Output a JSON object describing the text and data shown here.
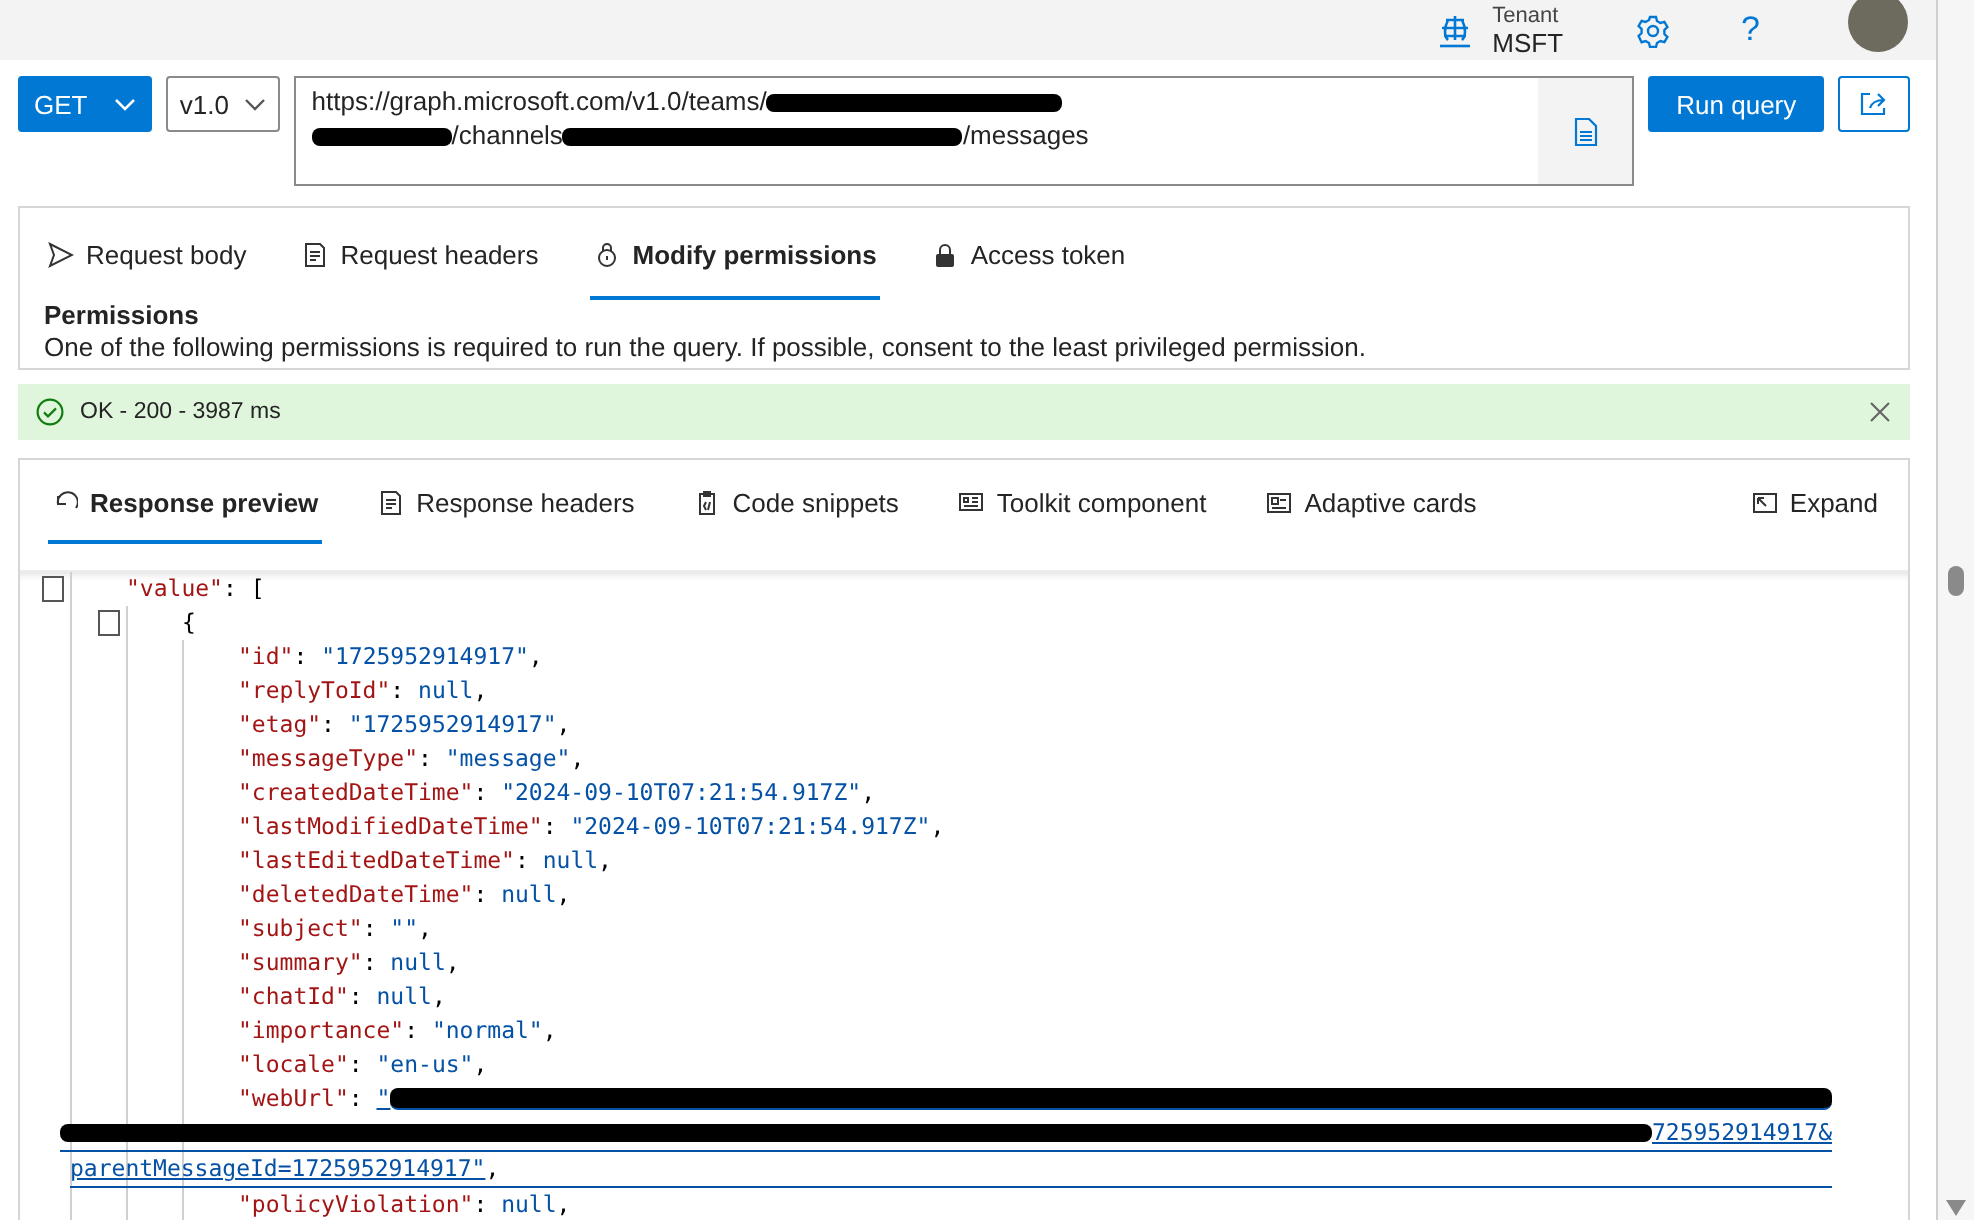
{
  "header": {
    "tenant_label": "Tenant",
    "tenant": "MSFT",
    "help": "?"
  },
  "request": {
    "method": "GET",
    "version": "v1.0",
    "run_label": "Run query",
    "url_lines": [
      [
        {
          "kind": "text",
          "text": "https://graph.microsoft.com/v1.0/teams/"
        },
        {
          "kind": "redaction"
        }
      ],
      [
        {
          "kind": "redaction"
        },
        {
          "kind": "text",
          "text": "/channels"
        },
        {
          "kind": "redaction"
        },
        {
          "kind": "text",
          "text": "/messages"
        }
      ]
    ]
  },
  "request_tabs": [
    {
      "label": "Request body",
      "selected": false
    },
    {
      "label": "Request headers",
      "selected": false
    },
    {
      "label": "Modify permissions",
      "selected": true
    },
    {
      "label": "Access token",
      "selected": false
    }
  ],
  "permissions": {
    "title": "Permissions",
    "text": "One of the following permissions is required to run the query. If possible, consent to the least privileged permission."
  },
  "status": {
    "text": "OK - 200 - 3987 ms"
  },
  "response_tabs": [
    {
      "label": "Response preview",
      "selected": true
    },
    {
      "label": "Response headers",
      "selected": false
    },
    {
      "label": "Code snippets",
      "selected": false
    },
    {
      "label": "Toolkit component",
      "selected": false
    },
    {
      "label": "Adaptive cards",
      "selected": false
    }
  ],
  "expand": "Expand",
  "code": [
    {
      "foldable": true,
      "parts": [
        {
          "kind": "key",
          "text": "\"value\""
        },
        {
          "kind": "punct",
          "text": ": ["
        }
      ],
      "children": [
        {
          "foldable": true,
          "parts": [
            {
              "kind": "punct",
              "text": "{"
            }
          ],
          "children": [
            {
              "parts": [
                {
                  "kind": "key",
                  "text": "\"id\""
                },
                {
                  "kind": "punct",
                  "text": ": "
                },
                {
                  "kind": "string",
                  "text": "\"1725952914917\""
                },
                {
                  "kind": "punct",
                  "text": ","
                }
              ]
            },
            {
              "parts": [
                {
                  "kind": "key",
                  "text": "\"replyToId\""
                },
                {
                  "kind": "punct",
                  "text": ": "
                },
                {
                  "kind": "null",
                  "text": "null"
                },
                {
                  "kind": "punct",
                  "text": ","
                }
              ]
            },
            {
              "parts": [
                {
                  "kind": "key",
                  "text": "\"etag\""
                },
                {
                  "kind": "punct",
                  "text": ": "
                },
                {
                  "kind": "string",
                  "text": "\"1725952914917\""
                },
                {
                  "kind": "punct",
                  "text": ","
                }
              ]
            },
            {
              "parts": [
                {
                  "kind": "key",
                  "text": "\"messageType\""
                },
                {
                  "kind": "punct",
                  "text": ": "
                },
                {
                  "kind": "string",
                  "text": "\"message\""
                },
                {
                  "kind": "punct",
                  "text": ","
                }
              ]
            },
            {
              "parts": [
                {
                  "kind": "key",
                  "text": "\"createdDateTime\""
                },
                {
                  "kind": "punct",
                  "text": ": "
                },
                {
                  "kind": "string",
                  "text": "\"2024-09-10T07:21:54.917Z\""
                },
                {
                  "kind": "punct",
                  "text": ","
                }
              ]
            },
            {
              "parts": [
                {
                  "kind": "key",
                  "text": "\"lastModifiedDateTime\""
                },
                {
                  "kind": "punct",
                  "text": ": "
                },
                {
                  "kind": "string",
                  "text": "\"2024-09-10T07:21:54.917Z\""
                },
                {
                  "kind": "punct",
                  "text": ","
                }
              ]
            },
            {
              "parts": [
                {
                  "kind": "key",
                  "text": "\"lastEditedDateTime\""
                },
                {
                  "kind": "punct",
                  "text": ": "
                },
                {
                  "kind": "null",
                  "text": "null"
                },
                {
                  "kind": "punct",
                  "text": ","
                }
              ]
            },
            {
              "parts": [
                {
                  "kind": "key",
                  "text": "\"deletedDateTime\""
                },
                {
                  "kind": "punct",
                  "text": ": "
                },
                {
                  "kind": "null",
                  "text": "null"
                },
                {
                  "kind": "punct",
                  "text": ","
                }
              ]
            },
            {
              "parts": [
                {
                  "kind": "key",
                  "text": "\"subject\""
                },
                {
                  "kind": "punct",
                  "text": ": "
                },
                {
                  "kind": "string",
                  "text": "\"\""
                },
                {
                  "kind": "punct",
                  "text": ","
                }
              ]
            },
            {
              "parts": [
                {
                  "kind": "key",
                  "text": "\"summary\""
                },
                {
                  "kind": "punct",
                  "text": ": "
                },
                {
                  "kind": "null",
                  "text": "null"
                },
                {
                  "kind": "punct",
                  "text": ","
                }
              ]
            },
            {
              "parts": [
                {
                  "kind": "key",
                  "text": "\"chatId\""
                },
                {
                  "kind": "punct",
                  "text": ": "
                },
                {
                  "kind": "null",
                  "text": "null"
                },
                {
                  "kind": "punct",
                  "text": ","
                }
              ]
            },
            {
              "parts": [
                {
                  "kind": "key",
                  "text": "\"importance\""
                },
                {
                  "kind": "punct",
                  "text": ": "
                },
                {
                  "kind": "string",
                  "text": "\"normal\""
                },
                {
                  "kind": "punct",
                  "text": ","
                }
              ]
            },
            {
              "parts": [
                {
                  "kind": "key",
                  "text": "\"locale\""
                },
                {
                  "kind": "punct",
                  "text": ": "
                },
                {
                  "kind": "string",
                  "text": "\"en-us\""
                },
                {
                  "kind": "punct",
                  "text": ","
                }
              ]
            },
            {
              "parts": [
                {
                  "kind": "key",
                  "text": "\"webUrl\""
                },
                {
                  "kind": "punct",
                  "text": ": "
                },
                {
                  "kind": "link",
                  "text": "\""
                },
                {
                  "kind": "redaction"
                }
              ],
              "rows": [
                [
                  {
                    "kind": "redaction"
                  },
                  {
                    "kind": "link",
                    "text": "725952914917&"
                  }
                ],
                [
                  {
                    "kind": "link",
                    "text": "parentMessageId=1725952914917\""
                  },
                  {
                    "kind": "punct",
                    "text": ","
                  }
                ]
              ]
            },
            {
              "parts": [
                {
                  "kind": "key",
                  "text": "\"policyViolation\""
                },
                {
                  "kind": "punct",
                  "text": ": "
                },
                {
                  "kind": "null",
                  "text": "null"
                },
                {
                  "kind": "punct",
                  "text": ","
                }
              ]
            }
          ]
        }
      ]
    }
  ]
}
